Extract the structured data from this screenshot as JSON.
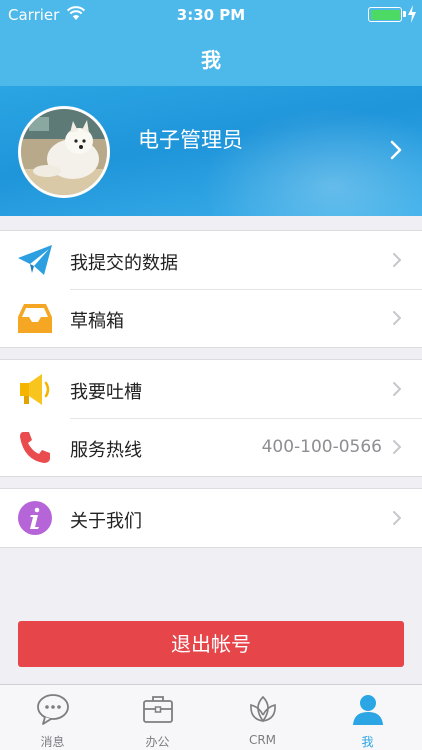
{
  "status_bar": {
    "carrier": "Carrier",
    "time": "3:30 PM"
  },
  "nav": {
    "title": "我"
  },
  "profile": {
    "name": "电子管理员"
  },
  "sections": [
    {
      "items": [
        {
          "label": "我提交的数据",
          "icon": "paper-plane-icon"
        },
        {
          "label": "草稿箱",
          "icon": "inbox-tray-icon"
        }
      ]
    },
    {
      "items": [
        {
          "label": "我要吐槽",
          "icon": "megaphone-icon"
        },
        {
          "label": "服务热线",
          "value": "400-100-0566",
          "icon": "phone-icon"
        }
      ]
    },
    {
      "items": [
        {
          "label": "关于我们",
          "icon": "info-icon"
        }
      ]
    }
  ],
  "logout_label": "退出帐号",
  "tabs": [
    {
      "label": "消息",
      "icon": "chat-bubble-icon"
    },
    {
      "label": "办公",
      "icon": "briefcase-icon"
    },
    {
      "label": "CRM",
      "icon": "crm-leaf-icon"
    },
    {
      "label": "我",
      "icon": "person-icon",
      "active": true
    }
  ],
  "colors": {
    "theme_blue": "#4db8ea",
    "logout_red": "#e6454a",
    "active_tab": "#2ba5e3"
  }
}
